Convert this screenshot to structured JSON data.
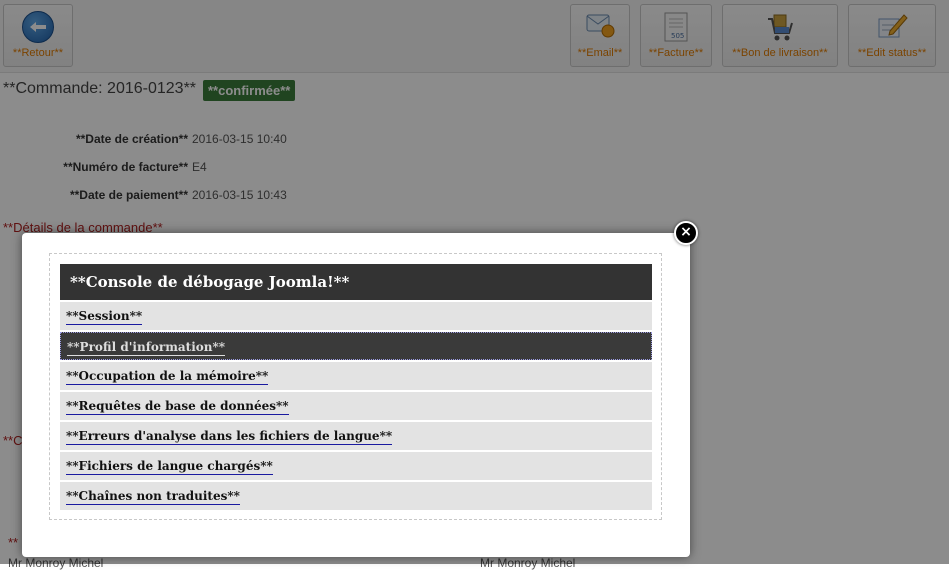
{
  "toolbar": {
    "back_label": "**Retour**",
    "email_label": "**Email**",
    "invoice_label": "**Facture**",
    "delivery_label": "**Bon de livraison**",
    "edit_status_label": "**Edit status**",
    "invoice_icon_text": "505"
  },
  "order": {
    "title": "**Commande: 2016-0123**",
    "status": "**confirmée**",
    "fields": [
      {
        "label": "**Date de création**",
        "value": "2016-03-15 10:40"
      },
      {
        "label": "**Numéro de facture**",
        "value": "E4"
      },
      {
        "label": "**Date de paiement**",
        "value": "2016-03-15 10:43"
      }
    ],
    "details_title": "**Détails de la commande**",
    "partial_section_1": "**C",
    "partial_section_2": "**",
    "customer_left": "Mr Monroy Michel",
    "customer_right": "Mr Monroy Michel"
  },
  "modal": {
    "close_symbol": "×",
    "console_title": "**Console de débogage Joomla!**",
    "items": [
      {
        "label": "**Session**"
      },
      {
        "label": "**Profil d'information**"
      },
      {
        "label": "**Occupation de la mémoire**"
      },
      {
        "label": "**Requêtes de base de données**"
      },
      {
        "label": "**Erreurs d'analyse dans les fichiers de langue**"
      },
      {
        "label": "**Fichiers de langue chargés**"
      },
      {
        "label": "**Chaînes non traduites**"
      }
    ]
  }
}
